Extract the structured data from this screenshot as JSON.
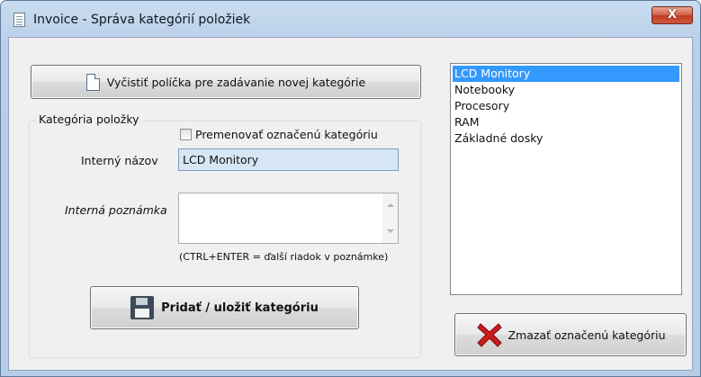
{
  "window": {
    "title": "Invoice - Správa kategórií položiek",
    "close_glyph": "X"
  },
  "toolbar": {
    "clear_label": "Vyčistiť políčka pre zadávanie novej kategórie",
    "clear_icon": "new-document-icon"
  },
  "form": {
    "group_label": "Kategória položky",
    "rename_label": "Premenovať označenú kategóriu",
    "rename_checked": false,
    "name_label": "Interný názov",
    "name_value": "LCD Monitory",
    "note_label": "Interná poznámka",
    "note_value": "",
    "hint": "(CTRL+ENTER = ďalší riadok v poznámke)",
    "save_label": "Pridať / uložiť kategóriu",
    "save_icon": "floppy-disk-icon"
  },
  "categories": {
    "items": [
      "LCD Monitory",
      "Notebooky",
      "Procesory",
      "RAM",
      "Základné dosky"
    ],
    "selected": "LCD Monitory"
  },
  "delete": {
    "label": "Zmazať označenú kategóriu",
    "icon": "red-x-icon"
  },
  "colors": {
    "selection": "#3399ff",
    "input_highlight": "#d7e6f5",
    "delete_icon": "#cc1a1a"
  }
}
